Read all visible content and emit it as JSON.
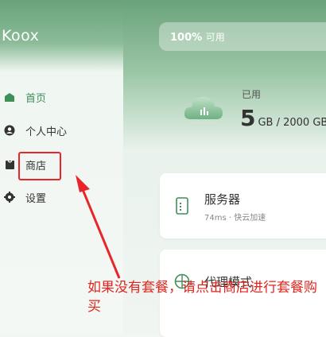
{
  "brand": "Koox",
  "sidebar": {
    "items": [
      {
        "label": "首页",
        "icon": "home-icon",
        "active": true
      },
      {
        "label": "个人中心",
        "icon": "user-icon",
        "active": false
      },
      {
        "label": "商店",
        "icon": "shop-bag-icon",
        "active": false
      },
      {
        "label": "设置",
        "icon": "gear-icon",
        "active": false
      }
    ]
  },
  "usage": {
    "percent_text": "100%",
    "percent_label": "可用",
    "available_fraction": 1.0
  },
  "traffic": {
    "label": "已用",
    "value": "5",
    "unit_total": "GB / 2000 GB"
  },
  "cards": [
    {
      "title": "服务器",
      "subtitle": "74ms · 快云加速",
      "icon": "server-doc-icon"
    },
    {
      "title": "代理模式",
      "icon": "globe-icon"
    }
  ],
  "annotation": {
    "text": "如果没有套餐，请点击商店进行套餐购买",
    "color": "#e0261f"
  },
  "colors": {
    "accent": "#3f8f5a",
    "highlight": "#e8262a"
  }
}
